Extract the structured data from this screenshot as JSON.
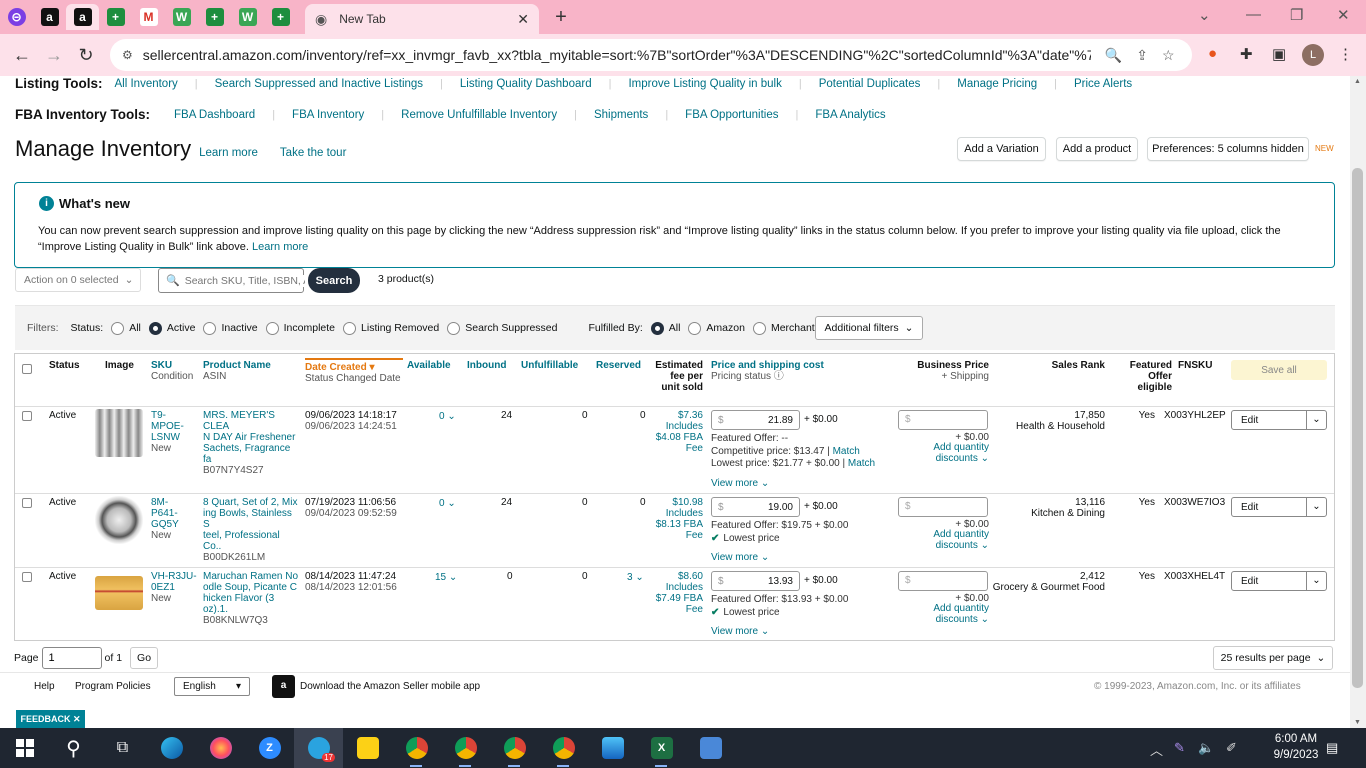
{
  "browser": {
    "active_tab_title": "New Tab",
    "url": "sellercentral.amazon.com/inventory/ref=xx_invmgr_favb_xx?tbla_myitable=sort:%7B\"sortOrder\"%3A\"DESCENDING\"%2C\"sortedColumnId\"%3A\"date\"%7...",
    "profile_initial": "L",
    "pinned_tabs": [
      "a",
      "a",
      "+",
      "M",
      "W",
      "+",
      "W",
      "+"
    ]
  },
  "listing_tools": {
    "label": "Listing Tools:",
    "links": [
      "All Inventory",
      "Search Suppressed and Inactive Listings",
      "Listing Quality Dashboard",
      "Improve Listing Quality in bulk",
      "Potential Duplicates",
      "Manage Pricing",
      "Price Alerts"
    ]
  },
  "fba_tools": {
    "label": "FBA Inventory Tools:",
    "links": [
      "FBA Dashboard",
      "FBA Inventory",
      "Remove Unfulfillable Inventory",
      "Shipments",
      "FBA Opportunities",
      "FBA Analytics"
    ]
  },
  "header": {
    "title": "Manage Inventory",
    "learn_more": "Learn more",
    "tour": "Take the tour",
    "add_variation": "Add a Variation",
    "add_product": "Add a product",
    "preferences": "Preferences: 5 columns hidden",
    "new_badge": "NEW"
  },
  "whats_new": {
    "title": "What's new",
    "body": "You can now prevent search suppression and improve listing quality on this page by clicking the new “Address suppression risk” and “Improve listing quality” links in the status column below. If you prefer to improve your listing quality via file upload, click the “Improve Listing Quality in Bulk” link above.",
    "learn_more": "Learn more"
  },
  "toolbar": {
    "action": "Action on 0 selected",
    "search_placeholder": "Search SKU, Title, ISBN, ASIN",
    "search_button": "Search",
    "count": "3 product(s)"
  },
  "filters": {
    "label": "Filters:",
    "status_label": "Status:",
    "status_options": [
      "All",
      "Active",
      "Inactive",
      "Incomplete",
      "Listing Removed",
      "Search Suppressed"
    ],
    "status_selected": "Active",
    "fulfilled_label": "Fulfilled By:",
    "fulfilled_options": [
      "All",
      "Amazon",
      "Merchant"
    ],
    "fulfilled_selected": "All",
    "additional": "Additional filters"
  },
  "columns": {
    "status": "Status",
    "image": "Image",
    "sku": "SKU",
    "condition": "Condition",
    "product_name": "Product Name",
    "asin": "ASIN",
    "date_created": "Date Created",
    "status_changed": "Status Changed Date",
    "available": "Available",
    "inbound": "Inbound",
    "unfulfillable": "Unfulfillable",
    "reserved": "Reserved",
    "fee_1": "Estimated",
    "fee_2": "fee per",
    "fee_3": "unit sold",
    "price": "Price and shipping cost",
    "pricing_status": "Pricing status",
    "business_price": "Business Price",
    "shipping": "+ Shipping",
    "sales_rank": "Sales Rank",
    "featured_1": "Featured",
    "featured_2": "Offer",
    "featured_3": "eligible",
    "fnsku": "FNSKU",
    "save_all": "Save all"
  },
  "rows": [
    {
      "status": "Active",
      "sku": [
        "T9-",
        "MPOE-",
        "LSNW"
      ],
      "condition": "New",
      "name": [
        "MRS. MEYER'S CLEA",
        "N DAY Air Freshener",
        "Sachets, Fragrance fa"
      ],
      "asin": "B07N7Y4S27",
      "created": "09/06/2023 14:18:17",
      "changed": "09/06/2023 14:24:51",
      "available": "0",
      "inbound": "24",
      "unfulfillable": "0",
      "reserved": "0",
      "fee": "$7.36",
      "fee_inc": "Includes",
      "fee_fba": "$4.08 FBA",
      "fee_word": "Fee",
      "price": "21.89",
      "ship": "+ $0.00",
      "featured_offer": "Featured Offer: --",
      "competitive": "Competitive price: $13.47",
      "lowest": "Lowest price: $21.77 + $0.00",
      "match": "Match",
      "view_more": "View more",
      "biz_ship": "+ $0.00",
      "add_qty_1": "Add quantity",
      "add_qty_2": "discounts",
      "rank": "17,850",
      "category": "Health & Household",
      "featured": "Yes",
      "fnsku": "X003YHL2EP",
      "edit": "Edit"
    },
    {
      "status": "Active",
      "sku": [
        "8M-",
        "P641-",
        "GQ5Y"
      ],
      "condition": "New",
      "name": [
        "8 Quart, Set of 2, Mix",
        "ing Bowls, Stainless S",
        "teel, Professional Co.."
      ],
      "asin": "B00DK261LM",
      "created": "07/19/2023 11:06:56",
      "changed": "09/04/2023 09:52:59",
      "available": "0",
      "inbound": "24",
      "unfulfillable": "0",
      "reserved": "0",
      "fee": "$10.98",
      "fee_inc": "Includes",
      "fee_fba": "$8.13 FBA",
      "fee_word": "Fee",
      "price": "19.00",
      "ship": "+ $0.00",
      "featured_offer": "Featured Offer: $19.75 + $0.00",
      "lowest_badge": "Lowest price",
      "view_more": "View more",
      "biz_ship": "+ $0.00",
      "add_qty_1": "Add quantity",
      "add_qty_2": "discounts",
      "rank": "13,116",
      "category": "Kitchen & Dining",
      "featured": "Yes",
      "fnsku": "X003WE7IO3",
      "edit": "Edit"
    },
    {
      "status": "Active",
      "sku": [
        "VH-R3JU-",
        "0EZ1"
      ],
      "condition": "New",
      "name": [
        "Maruchan Ramen No",
        "odle Soup, Picante C",
        "hicken Flavor (3 oz).1."
      ],
      "asin": "B08KNLW7Q3",
      "created": "08/14/2023 11:47:24",
      "changed": "08/14/2023 12:01:56",
      "available": "15",
      "inbound": "0",
      "unfulfillable": "0",
      "reserved": "3",
      "fee": "$8.60",
      "fee_inc": "Includes",
      "fee_fba": "$7.49 FBA",
      "fee_word": "Fee",
      "price": "13.93",
      "ship": "+ $0.00",
      "featured_offer": "Featured Offer: $13.93 + $0.00",
      "lowest_badge": "Lowest price",
      "view_more": "View more",
      "biz_ship": "+ $0.00",
      "add_qty_1": "Add quantity",
      "add_qty_2": "discounts",
      "rank": "2,412",
      "category": "Grocery & Gourmet Food",
      "featured": "Yes",
      "fnsku": "X003XHEL4T",
      "edit": "Edit"
    }
  ],
  "pagination": {
    "page_label": "Page",
    "page_value": "1",
    "of": "of 1",
    "go": "Go",
    "per_page": "25 results per page"
  },
  "footer": {
    "help": "Help",
    "policies": "Program Policies",
    "language": "English",
    "app": "Download the Amazon Seller mobile app",
    "copyright": "© 1999-2023, Amazon.com, Inc. or its affiliates",
    "feedback": "FEEDBACK"
  },
  "taskbar": {
    "time": "6:00 AM",
    "date": "9/9/2023",
    "badge": "17"
  }
}
